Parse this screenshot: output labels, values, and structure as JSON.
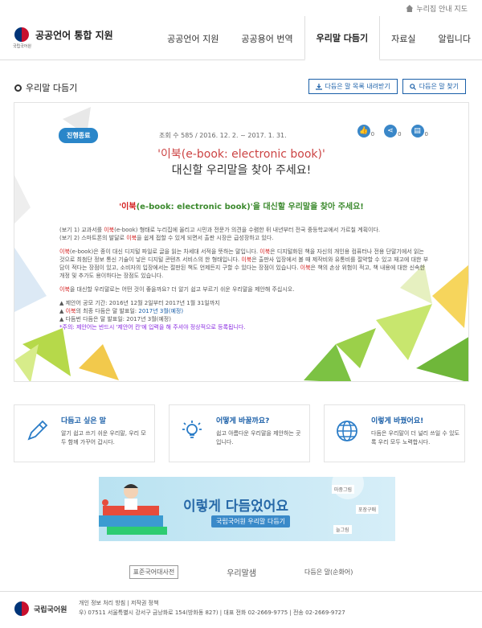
{
  "util": {
    "sitemap": "누리집 안내 지도"
  },
  "brand": {
    "name": "공공언어 통합 지원",
    "emblem_sub": "국립국어원"
  },
  "nav": [
    "공공언어 지원",
    "공공용어 번역",
    "우리말 다듬기",
    "자료실",
    "알립니다"
  ],
  "page": {
    "title": "우리말 다듬기",
    "btn_download": "다듬은 말 목록 내려받기",
    "btn_search": "다듬은 말 찾기"
  },
  "post": {
    "status": "진행종료",
    "meta": "조회 수 585 / 2016. 12. 2. ~ 2017. 1. 31.",
    "likes": "0",
    "shares": "0",
    "docs": "0",
    "title1": "'이북(e-book: electronic book)'",
    "title2": "대신할 우리말을 찾아 주세요!",
    "headline_a": "'이북",
    "headline_b": "(e-book: electronic book)'을 대신할 우리말을 찾아 주세요!",
    "ex1": "(보기 1) 교과서를 ",
    "ex1_red": "이북",
    "ex1_rest": "(e-book) 형태로 누리집에 올리고 시민과 전문가 의견을 수렴한 뒤 내년부터 전국 중등학교에서 가르칠 계획이다.",
    "ex2": "(보기 2) 스마트폰의 발달로 ",
    "ex2_red": "이북",
    "ex2_rest": "을 쉽게 접할 수 있게 되면서 출판 시장은 급성장하고 있다.",
    "desc_red1": "이북",
    "desc1": "(e-book)은 종이 대신 디지털 파일로 글을 읽는 차세대 서적을 뜻하는 말입니다. ",
    "desc_red2": "이북",
    "desc2": "은 디지털화된 책을 자신의 개인용 컴퓨터나 전용 단말기에서 읽는 것으로 최첨단 정보 통신 기술이 낳은 디지털 콘텐츠 서비스의 한 형태입니다. ",
    "desc_red3": "이북",
    "desc3": "은 출판사 입장에서 볼 때 제작비와 유통비를 절약할 수 있고 재고에 대한 부담이 적다는 장점이 있고, 소비자의 입장에서는 절판된 책도 언제든지 구할 수 있다는 장점이 있습니다. ",
    "desc_red4": "이북",
    "desc4": "은 책의 손상 위험이 적고, 책 내용에 대한 신속한 개정 및 추가도 용이하다는 장점도 있습니다.",
    "ask_red": "이북",
    "ask": "을 대신할 우리말로는 어떤 것이 좋을까요? 더 알기 쉽고 부르기 쉬운 우리말을 제안해 주십시오.",
    "sched1": "▲ 제안어 공모 기간: 2016년 12월 2일부터 2017년 1월 31일까지",
    "sched2a": "▲ ",
    "sched2_red": "이북",
    "sched2b": "의 최종 다듬은 말 발표일: ",
    "sched2_blue": "2017년 3월(예정)",
    "sched3": "▲ 다듬번 다듬은 말 발표일: 2017년 3월(예정)",
    "notice": "*주의: 제안어는 반드시 '제안어 칸'에 입력을 해 주셔야 정상적으로 등록됩니다."
  },
  "features": [
    {
      "title": "다듬고 싶은 말",
      "desc": "알기 쉽고 쓰기 쉬운 우리말, 우리 모두 함께 가꾸어 갑시다."
    },
    {
      "title": "어떻게 바꿀까요?",
      "desc": "쉽고 아름다운 우리말을 제안하는 곳입니다."
    },
    {
      "title": "이렇게 바꿨어요!",
      "desc": "다듬은 우리말이 더 널리 쓰일 수 있도록 우리 모두 노력합시다."
    }
  ],
  "banner": {
    "main": "이렇게 다듬었어요",
    "sub": "국립국어원 우리말 다듬기",
    "tag1": "마중그림",
    "tag2": "포장구매",
    "tag3": "늘그림"
  },
  "family": [
    "표준국어대사전",
    "우리말샘",
    "다듬은 말(순화어)"
  ],
  "footer": {
    "org": "국립국어원",
    "links": "개인 정보 처리 방침 | 저작권 정책",
    "addr": "우) 07511 서울특별시 강서구 금낭화로 154(방화동 827) | 대표 전화 02-2669-9775 | 전송 02-2669-9727"
  }
}
